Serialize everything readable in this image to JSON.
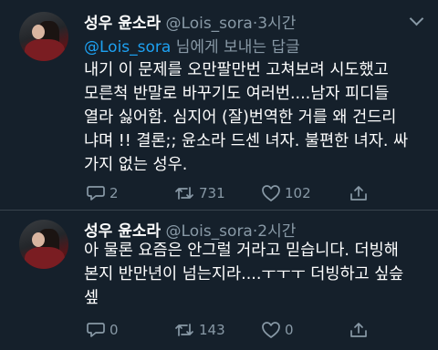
{
  "tweets": [
    {
      "author_name": "성우 윤소라",
      "author_handle": "@Lois_sora",
      "separator": "·",
      "time": "3시간",
      "reply_mention": "@Lois_sora",
      "reply_suffix": " 님에게 보내는 답글",
      "lines": [
        "내기 이 문제를 오만팔만번 고쳐보려 시도했고",
        "모른척 반말로 바꾸기도 여러번....남자 피디들",
        "열라 싫어함. 심지어 (잘)번역한 거를 왜 건드리",
        "냐며 !! 결론;; 윤소라 드센 녀자. 불편한 녀자. 싸",
        "가지 없는 성우."
      ],
      "reply_count": "2",
      "retweet_count": "731",
      "like_count": "102"
    },
    {
      "author_name": "성우 윤소라",
      "author_handle": "@Lois_sora",
      "separator": "·",
      "time": "2시간",
      "lines": [
        "아 물론 요즘은 안그럴 거라고 믿습니다. 더빙해",
        "본지 반만년이 넘는지라....ㅜㅜㅜ 더빙하고 싶슾",
        "셒"
      ],
      "reply_count": "0",
      "retweet_count": "143",
      "like_count": "0"
    }
  ],
  "icons": {
    "reply": "reply-icon",
    "retweet": "retweet-icon",
    "like": "heart-icon",
    "share": "share-icon",
    "menu": "chevron-down-icon"
  },
  "colors": {
    "background": "#15202b",
    "text": "#ffffff",
    "secondary": "#8899a6",
    "link": "#1da1f2",
    "divider": "#38444d"
  }
}
